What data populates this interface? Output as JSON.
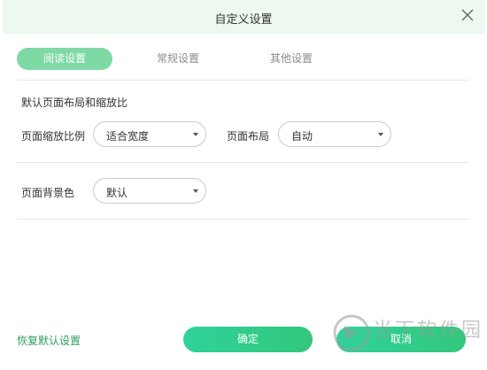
{
  "dialog": {
    "title": "自定义设置",
    "close_icon": "close-icon"
  },
  "tabs": [
    {
      "label": "阅读设置",
      "active": true
    },
    {
      "label": "常规设置",
      "active": false
    },
    {
      "label": "其他设置",
      "active": false
    }
  ],
  "reading": {
    "section_title": "默认页面布局和缩放比",
    "zoom_label": "页面缩放比例",
    "zoom_value": "适合宽度",
    "layout_label": "页面布局",
    "layout_value": "自动",
    "background_label": "页面背景色",
    "background_value": "默认"
  },
  "footer": {
    "restore_label": "恢复默认设置",
    "ok_label": "确定",
    "cancel_label": "取消"
  },
  "watermark": {
    "text": "当下软件园",
    "icon": "watermark-logo"
  },
  "colors": {
    "accent": "#33c77c",
    "active_tab": "#7ed9a4",
    "title_bar": "#edf8ef",
    "restore_link": "#2f9e5b"
  }
}
